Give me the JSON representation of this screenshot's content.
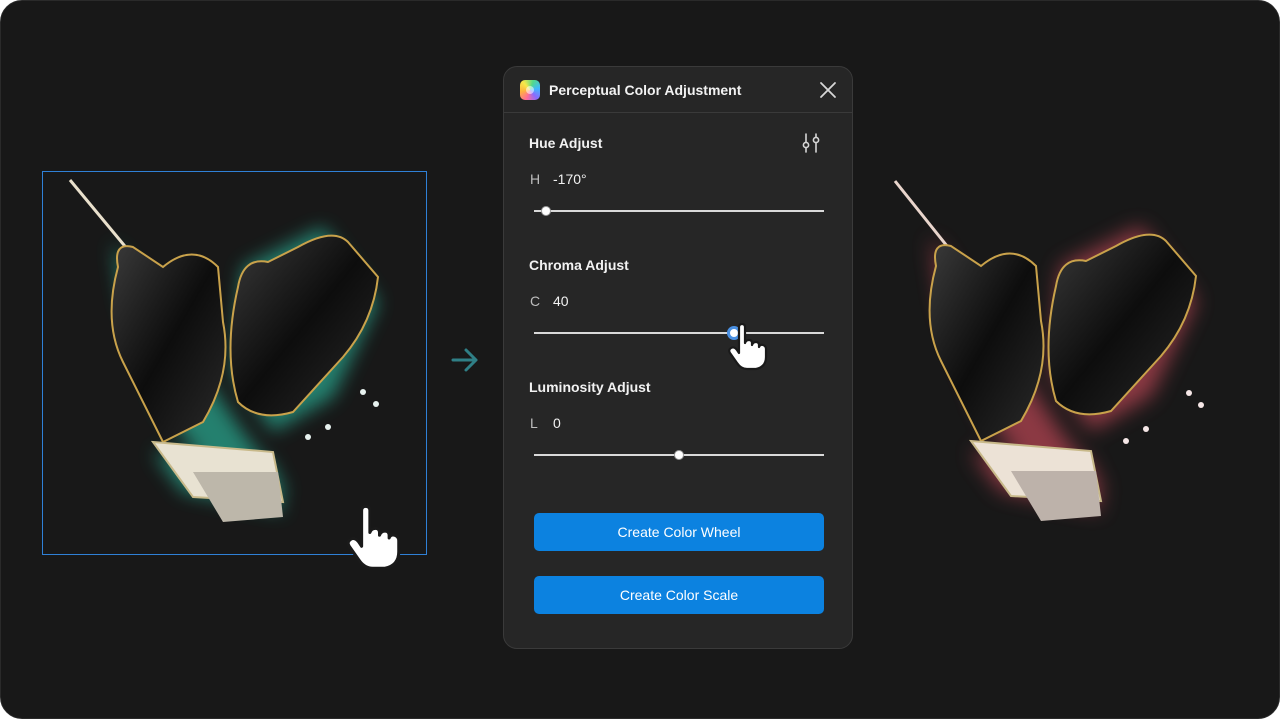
{
  "panel": {
    "title": "Perceptual Color Adjustment",
    "icons": {
      "app": "plugin-logo-icon",
      "close": "close-icon",
      "settings": "sliders-icon"
    }
  },
  "hue": {
    "title": "Hue Adjust",
    "letter": "H",
    "value": "-170°",
    "position": 0.04
  },
  "chroma": {
    "title": "Chroma Adjust",
    "letter": "C",
    "value": "40",
    "position": 0.69
  },
  "luminosity": {
    "title": "Luminosity Adjust",
    "letter": "L",
    "value": "0",
    "position": 0.5
  },
  "buttons": {
    "wheel": "Create Color Wheel",
    "scale": "Create Color Scale"
  },
  "colors": {
    "background": "#181818",
    "panel": "#262626",
    "accent": "#0c82e0",
    "selection": "#2f80d6",
    "glow_before": "#2fd6b6",
    "glow_after": "#ff5a6e",
    "arrow": "#2f7f86"
  }
}
